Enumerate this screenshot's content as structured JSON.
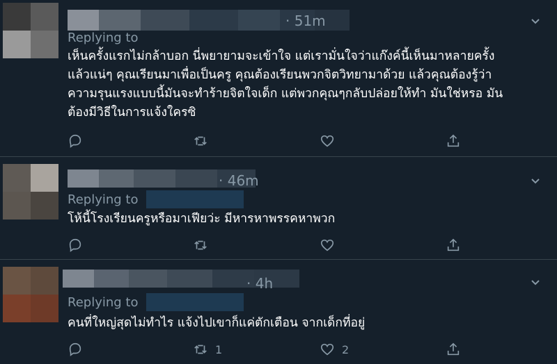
{
  "tweets": [
    {
      "time": "· 51m",
      "replying_label": "Replying to",
      "text_lines": [
        "เห็นครั้งแรกไม่กล้าบอก นี่พยายามจะเข้าใจ แต่เรามั่นใจว่าแก๊งค์นี้เห็นมาหลายครั้ง",
        "แล้วแน่ๆ คุณเรียนมาเพื่อเป็นครู คุณต้องเรียนพวกจิตวิทยามาด้วย แล้วคุณต้องรู้ว่า",
        "ความรุนแรงแบบนี้มันจะทำร้ายจิตใจเด็ก แต่พวกคุณๆกลับปล่อยให้ทำ มันใช่หรอ มัน",
        "ต้องมีวิธีในการแจ้งใครซิ"
      ],
      "retweet_count": "",
      "like_count": ""
    },
    {
      "time": "· 46m",
      "replying_label": "Replying to",
      "text_lines": [
        "โห้นี้โรงเรียนครูหรือมาเฟียว่ะ มีหารหาพรรคหาพวก"
      ],
      "retweet_count": "",
      "like_count": ""
    },
    {
      "time": "· 4h",
      "replying_label": "Replying to",
      "text_lines": [
        "คนที่ใหญ่สุดไม่ทำไร แจ้งไปเขาก็แค่ตักเตือน จากเด็กที่อยู่"
      ],
      "retweet_count": "1",
      "like_count": "2"
    }
  ],
  "icons": {
    "reply": "reply-icon",
    "retweet": "retweet-icon",
    "like": "like-icon",
    "share": "share-icon",
    "more": "chevron-down-icon"
  },
  "colors": {
    "background": "#15202b",
    "muted_text": "#8899a6",
    "divider": "#38444d"
  }
}
